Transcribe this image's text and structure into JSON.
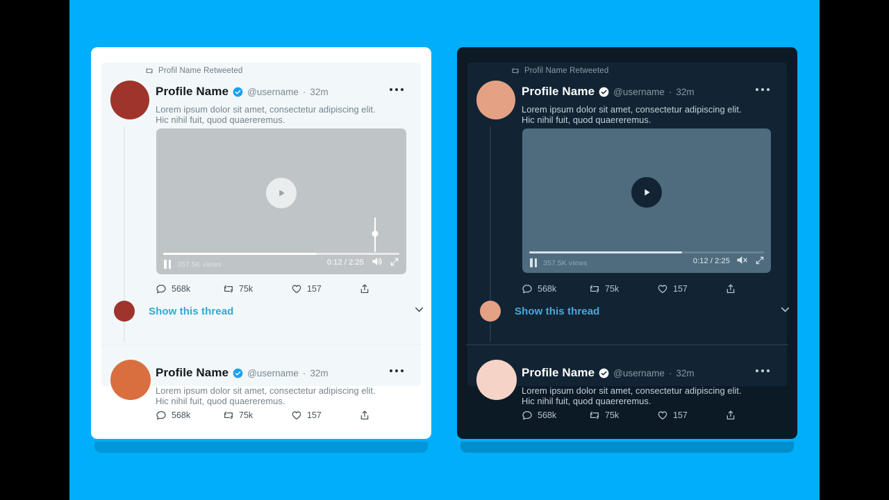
{
  "background": {
    "outer_color": "#000000",
    "canvas_color": "#00AEFA"
  },
  "cards": [
    {
      "theme": "light",
      "colors": {
        "card_bg": "#FFFFFF",
        "panel_bg": "#F2F8FA",
        "avatar_main": "#9E342B",
        "avatar_small": "#9E342B",
        "avatar_second": "#D96F3F",
        "verified_badge": "#1DA1F2",
        "link": "#31A8D4",
        "video_bg": "#BFC5C7"
      },
      "retweet_notice": {
        "icon": "retweet-icon",
        "text": "Profil Name Retweeted"
      },
      "tweets": [
        {
          "name": "Profile Name",
          "verified": true,
          "handle": "@username",
          "separator": "·",
          "time": "32m",
          "text": "Lorem ipsum dolor sit amet, consectetur adipiscing elit.\nHic nihil fuit, quod quaereremus.",
          "more_label": "More options",
          "video": {
            "views": "357.5K views",
            "time_current": "0:12",
            "time_total": "2:25",
            "time_display": "0:12 / 2:25",
            "progress_percent": 65,
            "muted": false,
            "playing": true,
            "volume_percent": 55,
            "play_icon": "play-icon",
            "pause_icon": "pause-icon",
            "volume_icon": "volume-on-icon",
            "fullscreen_icon": "fullscreen-icon"
          },
          "actions": [
            {
              "icon": "reply-icon",
              "label": "568k"
            },
            {
              "icon": "retweet-icon",
              "label": "75k"
            },
            {
              "icon": "like-icon",
              "label": "157"
            },
            {
              "icon": "share-icon",
              "label": ""
            }
          ],
          "thread": {
            "label": "Show this thread",
            "chevron_icon": "chevron-down-icon"
          }
        },
        {
          "name": "Profile Name",
          "verified": true,
          "handle": "@username",
          "separator": "·",
          "time": "32m",
          "text": "Lorem ipsum dolor sit amet, consectetur adipiscing elit.\nHic nihil fuit, quod quaereremus.",
          "more_label": "More options",
          "actions": [
            {
              "icon": "reply-icon",
              "label": "568k"
            },
            {
              "icon": "retweet-icon",
              "label": "75k"
            },
            {
              "icon": "like-icon",
              "label": "157"
            },
            {
              "icon": "share-icon",
              "label": ""
            }
          ]
        }
      ]
    },
    {
      "theme": "dark",
      "colors": {
        "card_bg": "#0C1A26",
        "panel_bg": "#122434",
        "avatar_main": "#E5A184",
        "avatar_small": "#E5A184",
        "avatar_second": "#F6D3C7",
        "verified_badge": "#FFFFFF",
        "link": "#4BA8D8",
        "video_bg": "#4F6B7E"
      },
      "retweet_notice": {
        "icon": "retweet-icon",
        "text": "Profil Name Retweeted"
      },
      "tweets": [
        {
          "name": "Profile Name",
          "verified": true,
          "handle": "@username",
          "separator": "·",
          "time": "32m",
          "text": "Lorem ipsum dolor sit amet, consectetur adipiscing elit.\nHic nihil fuit, quod quaereremus.",
          "more_label": "More options",
          "video": {
            "views": "357.5K views",
            "time_current": "0:12",
            "time_total": "2:25",
            "time_display": "0:12 / 2:25",
            "progress_percent": 65,
            "muted": true,
            "playing": true,
            "play_icon": "play-icon",
            "pause_icon": "pause-icon",
            "volume_icon": "volume-muted-icon",
            "fullscreen_icon": "fullscreen-icon"
          },
          "actions": [
            {
              "icon": "reply-icon",
              "label": "568k"
            },
            {
              "icon": "retweet-icon",
              "label": "75k"
            },
            {
              "icon": "like-icon",
              "label": "157"
            },
            {
              "icon": "share-icon",
              "label": ""
            }
          ],
          "thread": {
            "label": "Show this thread",
            "chevron_icon": "chevron-down-icon"
          }
        },
        {
          "name": "Profile Name",
          "verified": true,
          "handle": "@username",
          "separator": "·",
          "time": "32m",
          "text": "Lorem ipsum dolor sit amet, consectetur adipiscing elit.\nHic nihil fuit, quod quaereremus.",
          "more_label": "More options",
          "actions": [
            {
              "icon": "reply-icon",
              "label": "568k"
            },
            {
              "icon": "retweet-icon",
              "label": "75k"
            },
            {
              "icon": "like-icon",
              "label": "157"
            },
            {
              "icon": "share-icon",
              "label": ""
            }
          ]
        }
      ]
    }
  ]
}
